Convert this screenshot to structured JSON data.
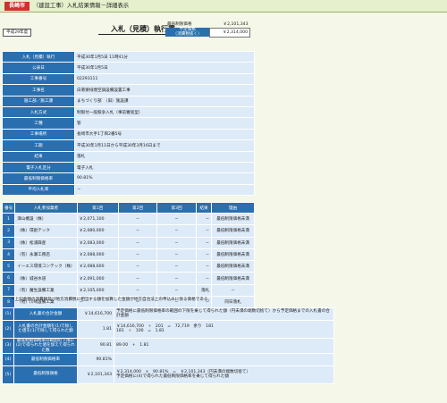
{
  "header": {
    "city": "長崎市",
    "title": "（建設工事）入札結果情報－詳細表示"
  },
  "era_badge": "平成29年度",
  "doc_title": "入札（見積）執行書",
  "price_cap": {
    "lowest_label": "最低制限価格",
    "lowest_value": "￥2,101,343",
    "planned_label": "予定価格\n（消費税抜く）",
    "planned_value": "￥2,314,000"
  },
  "details": [
    {
      "label": "入札（見積）執行",
      "value": "平成30年1月5日 11時41分"
    },
    {
      "label": "公表日",
      "value": "平成30年1月5日"
    },
    {
      "label": "工事番号",
      "value": "02293111"
    },
    {
      "label": "工事名",
      "value": "白菊寮排煙空調設備設置工事"
    },
    {
      "label": "施工部／施工課",
      "value": "まちづくり部　（旧）施設課"
    },
    {
      "label": "入札方式",
      "value": "制限付一般競争入札（事前審査型）"
    },
    {
      "label": "工種",
      "value": "管"
    },
    {
      "label": "工事場所",
      "value": "長崎市大手1丁目2番5号"
    },
    {
      "label": "工期",
      "value": "平成30年1月11日から平成30年3月16日まで"
    },
    {
      "label": "結果",
      "value": "落札"
    },
    {
      "label": "電子入札区分",
      "value": "電子入札"
    },
    {
      "label": "最低制限価格率",
      "value": "90.81%"
    },
    {
      "label": "平均入札率",
      "value": "－"
    }
  ],
  "bids": {
    "headers": [
      "番号",
      "入札参加業者",
      "第1回",
      "第2回",
      "第3回",
      "結果",
      "理由"
    ],
    "rows": [
      {
        "no": "1",
        "name": "澤山機設（株）",
        "r1": "￥2,071,100",
        "r2": "－",
        "r3": "－",
        "result": "－",
        "reason": "最低制限価格未満"
      },
      {
        "no": "2",
        "name": "（株）環創テック",
        "r1": "￥2,080,000",
        "r2": "－",
        "r3": "－",
        "result": "－",
        "reason": "最低制限価格未満"
      },
      {
        "no": "3",
        "name": "（株）松浦興産",
        "r1": "￥2,083,000",
        "r2": "－",
        "r3": "－",
        "result": "－",
        "reason": "最低制限価格未満"
      },
      {
        "no": "4",
        "name": "（有）永瀬工務店",
        "r1": "￥2,088,000",
        "r2": "－",
        "r3": "－",
        "result": "－",
        "reason": "最低制限価格未満"
      },
      {
        "no": "5",
        "name": "イーエス環境コンテック（株）",
        "r1": "￥2,088,600",
        "r2": "－",
        "r3": "－",
        "result": "－",
        "reason": "最低制限価格未満"
      },
      {
        "no": "6",
        "name": "（株）城谷水道",
        "r1": "￥2,091,000",
        "r2": "－",
        "r3": "－",
        "result": "－",
        "reason": "最低制限価格未満"
      },
      {
        "no": "7",
        "name": "（有）魔生設備工業",
        "r1": "￥2,105,000",
        "r2": "－",
        "r3": "－",
        "result": "落札",
        "reason": "－"
      },
      {
        "no": "8",
        "name": "（有）川崎設備工業",
        "r1": "－",
        "r2": "－",
        "r3": "－",
        "result": "－",
        "reason": "同日落札"
      }
    ]
  },
  "note": "＊上記金額の消費税及び地方消費税に相当する額を加算した金額が地方自治法上の申込みに係る価格である。",
  "calc": [
    {
      "no": "(1)",
      "label": "入札書の合計金額",
      "value": "￥14,616,700",
      "desc": "予定価格に最低制限価格率の範囲の下限を乗じて得られた額（円未満の端数切捨て）から予定価格までの入札書の合計金額"
    },
    {
      "no": "(2)",
      "label": "入札書の合計金額を(1)で除した値を(1)で除して得られた額",
      "value": "1.81",
      "desc": "￥14,616,700　÷　201　=　72,719　余り　181\n181　÷　100　=　1.81"
    },
    {
      "no": "(3)",
      "label": "最低制限価格率の範囲の下限に(2)で得られた値を加えて得られた数",
      "value": "90.81",
      "desc": "89.00　+　1.81"
    },
    {
      "no": "(4)",
      "label": "最低制限価格率",
      "value": "90.81%",
      "desc": ""
    },
    {
      "no": "(5)",
      "label": "最低制限価格",
      "value": "￥2,101,343",
      "desc": "￥2,314,000　×　90.81%　=　￥2,101,343（円未満の端数切捨て）\n予定価格に(4)で得られた最低制限価格率を乗じて得られた額"
    }
  ]
}
